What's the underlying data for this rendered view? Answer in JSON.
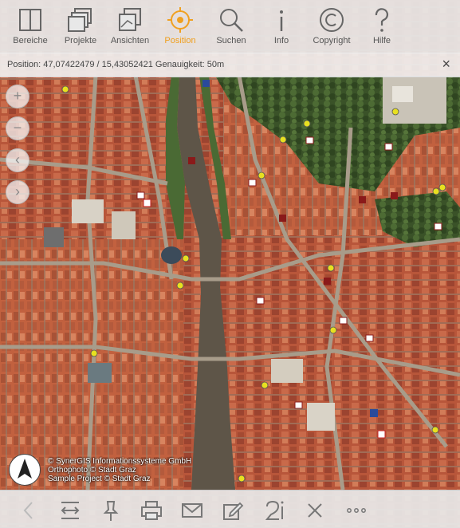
{
  "toolbar": {
    "items": [
      {
        "label": "Bereiche",
        "icon": "book-icon"
      },
      {
        "label": "Projekte",
        "icon": "layers-stack-icon"
      },
      {
        "label": "Ansichten",
        "icon": "map-view-icon"
      },
      {
        "label": "Position",
        "icon": "location-target-icon",
        "active": true
      },
      {
        "label": "Suchen",
        "icon": "search-icon"
      },
      {
        "label": "Info",
        "icon": "info-icon"
      },
      {
        "label": "Copyright",
        "icon": "copyright-icon"
      },
      {
        "label": "Hilfe",
        "icon": "help-icon"
      }
    ],
    "active_color": "#f0a020"
  },
  "position_bar": {
    "text": "Position: 47,07422479 / 15,43052421   Genauigkeit: 50m",
    "close_symbol": "×"
  },
  "map_controls": {
    "zoom_in": "+",
    "zoom_out": "−",
    "back": "‹",
    "forward": "›"
  },
  "attribution": {
    "line1": "© SynerGIS Informationssysteme GmbH",
    "line2": "Orthophoto © Stadt Graz",
    "line3": "Sample Project © Stadt Graz"
  },
  "bottom_toolbar": {
    "icons": [
      "back-arrow-icon",
      "measure-width-icon",
      "pin-icon",
      "print-icon",
      "mail-icon",
      "edit-icon",
      "redline-icon",
      "close-icon",
      "more-icon"
    ]
  },
  "colors": {
    "roof": "#b8563a",
    "river": "#5e5548",
    "vegetation": "#3f5a2c",
    "poi_yellow": "#e8e020",
    "poi_red": "#8a1a1a"
  }
}
